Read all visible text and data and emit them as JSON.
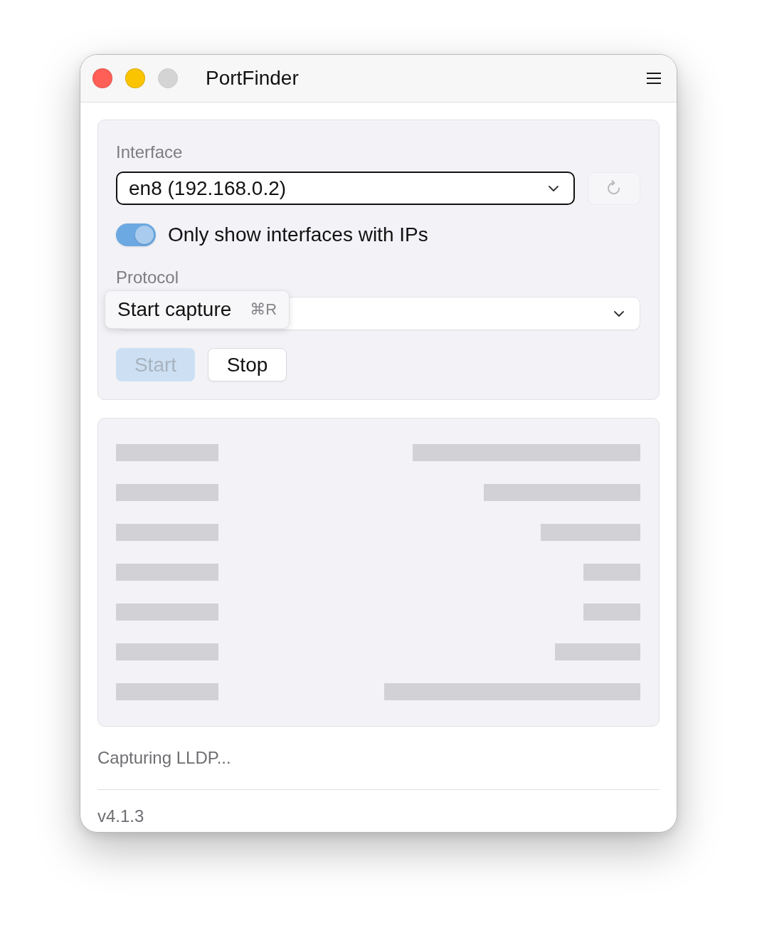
{
  "window": {
    "title": "PortFinder",
    "buttons": [
      {
        "kind": "close",
        "disabled": false
      },
      {
        "kind": "minimize",
        "disabled": false
      },
      {
        "kind": "zoom",
        "disabled": true
      }
    ]
  },
  "interface": {
    "label": "Interface",
    "value": "en8 (192.168.0.2)",
    "focused": true,
    "refresh": {
      "disabled": true
    }
  },
  "filter_toggle": {
    "label": "Only show interfaces with IPs",
    "on": true
  },
  "protocol": {
    "label": "Protocol",
    "focused": false
  },
  "tooltip": {
    "text": "Start capture",
    "shortcut": "⌘R"
  },
  "actions": [
    {
      "label": "Start",
      "kind": "primary",
      "disabled": true
    },
    {
      "label": "Stop",
      "kind": "secondary",
      "disabled": false
    }
  ],
  "results": {
    "loading": true
  },
  "status": "Capturing LLDP...",
  "version": "v4.1.3"
}
